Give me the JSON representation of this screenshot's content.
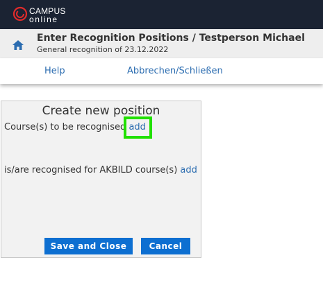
{
  "brand": {
    "line1": "CAMPUS",
    "line2": "online",
    "logo_icon": "campus-online-logo-icon"
  },
  "header": {
    "title": "Enter Recognition Positions  / Testperson Michael",
    "subtitle": "General recognition of 23.12.2022",
    "home_icon": "home-icon"
  },
  "menu": {
    "help": "Help",
    "cancel_close": "Abbrechen/Schließen"
  },
  "dialog": {
    "title": "Create new position",
    "courses_label": "Course(s) to be recognised",
    "courses_add": "add",
    "recognised_label": "is/are recognised for AKBILD course(s)",
    "recognised_add": "add",
    "save_button": "Save and Close",
    "cancel_button": "Cancel"
  },
  "colors": {
    "topbar": "#1b2333",
    "accent_red": "#e02b2b",
    "link": "#2b6cb0",
    "button": "#0d6fd1",
    "highlight": "#22e000"
  }
}
